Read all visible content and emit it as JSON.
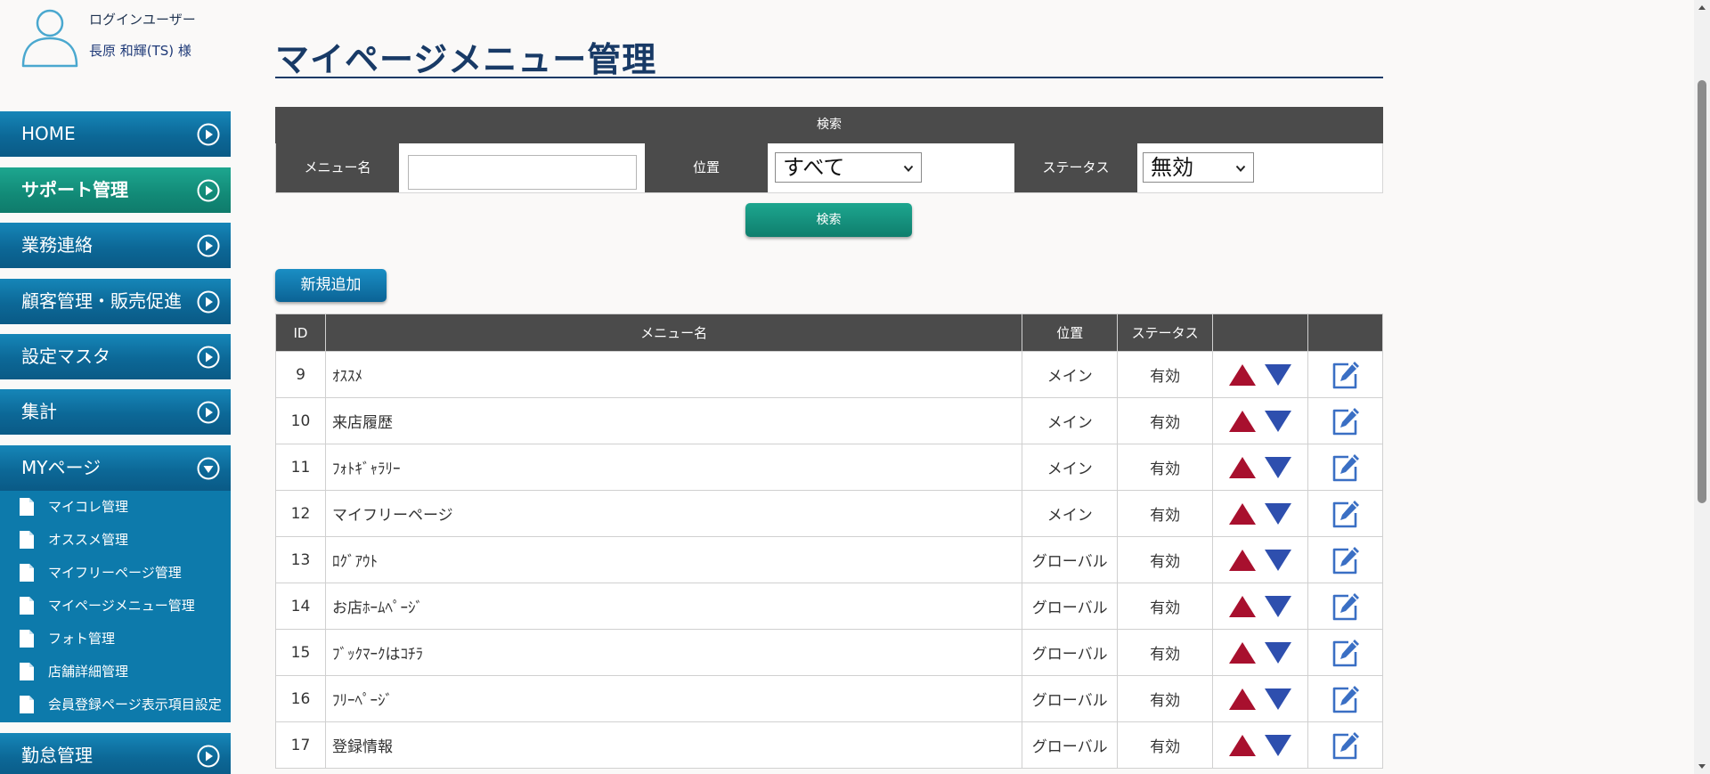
{
  "user": {
    "label": "ログインユーザー",
    "name": "長原 和輝(TS) 様"
  },
  "sidebar": {
    "items": [
      {
        "label": "HOME",
        "active": false
      },
      {
        "label": "サポート管理",
        "active": true
      },
      {
        "label": "業務連絡",
        "active": false
      },
      {
        "label": "顧客管理・販売促進",
        "active": false
      },
      {
        "label": "設定マスタ",
        "active": false
      },
      {
        "label": "集計",
        "active": false
      },
      {
        "label": "MYページ",
        "active": false,
        "expanded": true
      },
      {
        "label": "勤怠管理",
        "active": false
      }
    ],
    "submenu": [
      "マイコレ管理",
      "オススメ管理",
      "マイフリーページ管理",
      "マイページメニュー管理",
      "フォト管理",
      "店舗詳細管理",
      "会員登録ページ表示項目設定"
    ]
  },
  "page": {
    "title": "マイページメニュー管理"
  },
  "search": {
    "heading": "検索",
    "menu_name_label": "メニュー名",
    "menu_name_value": "",
    "position_label": "位置",
    "position_value": "すべて",
    "status_label": "ステータス",
    "status_value": "無効",
    "submit_label": "検索"
  },
  "add_button_label": "新規追加",
  "table": {
    "headers": {
      "id": "ID",
      "name": "メニュー名",
      "position": "位置",
      "status": "ステータス",
      "sort": "",
      "edit": ""
    },
    "rows": [
      {
        "id": "9",
        "name": "ｵｽｽﾒ",
        "position": "メイン",
        "status": "有効"
      },
      {
        "id": "10",
        "name": "来店履歴",
        "position": "メイン",
        "status": "有効"
      },
      {
        "id": "11",
        "name": "ﾌｫﾄｷﾞｬﾗﾘｰ",
        "position": "メイン",
        "status": "有効"
      },
      {
        "id": "12",
        "name": "マイフリーページ",
        "position": "メイン",
        "status": "有効"
      },
      {
        "id": "13",
        "name": "ﾛｸﾞｱｳﾄ",
        "position": "グローバル",
        "status": "有効"
      },
      {
        "id": "14",
        "name": "お店ﾎｰﾑﾍﾟｰｼﾞ",
        "position": "グローバル",
        "status": "有効"
      },
      {
        "id": "15",
        "name": "ﾌﾞｯｸﾏｰｸはｺﾁﾗ",
        "position": "グローバル",
        "status": "有効"
      },
      {
        "id": "16",
        "name": "ﾌﾘｰﾍﾟｰｼﾞ",
        "position": "グローバル",
        "status": "有効"
      },
      {
        "id": "17",
        "name": "登録情報",
        "position": "グローバル",
        "status": "有効"
      }
    ]
  },
  "colors": {
    "nav_blue": "#0c6897",
    "nav_active_green": "#128a77",
    "title_navy": "#183a66",
    "header_gray": "#4b4b4b",
    "sort_up_red": "#a8102e",
    "sort_down_blue": "#2e4fae",
    "edit_icon_blue": "#3a6fc4"
  },
  "icons": {
    "avatar": "user-outline-icon",
    "nav_arrow": "circle-play-icon",
    "nav_arrow_expanded": "circle-chevron-down-icon",
    "submenu": "document-icon",
    "sort_up": "triangle-up-icon",
    "sort_down": "triangle-down-icon",
    "edit": "edit-pencil-icon"
  }
}
